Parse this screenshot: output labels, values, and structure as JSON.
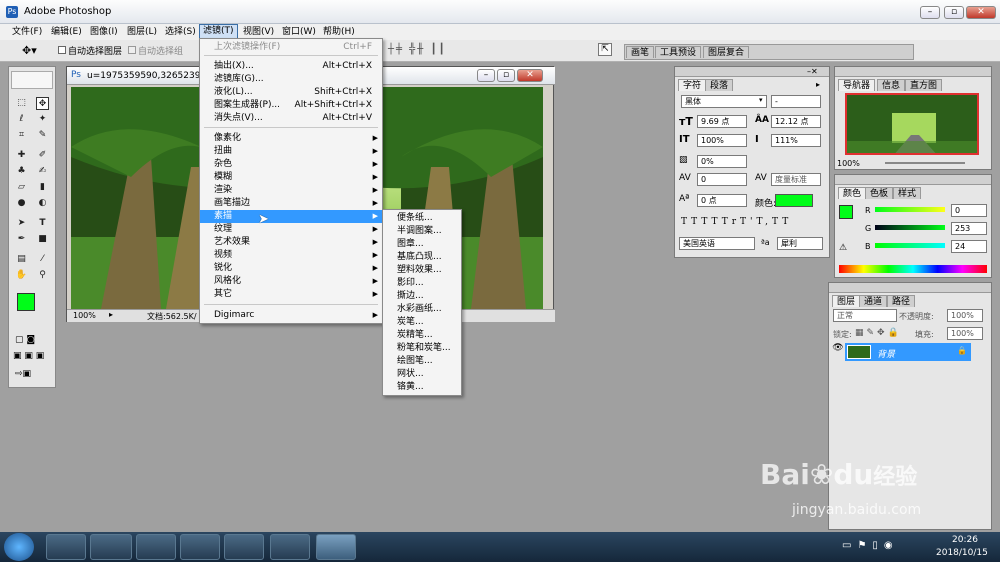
{
  "window": {
    "title": "Adobe Photoshop"
  },
  "menubar": [
    "文件(F)",
    "编辑(E)",
    "图像(I)",
    "图层(L)",
    "选择(S)",
    "滤镜(T)",
    "视图(V)",
    "窗口(W)",
    "帮助(H)"
  ],
  "options": {
    "auto_select_layer": "自动选择图层",
    "auto_select_group": "自动选择组",
    "right_tabs": [
      "画笔",
      "工具预设",
      "图层复合"
    ]
  },
  "document": {
    "title": "u=1975359590,3265239467",
    "zoom": "100%",
    "status": "文档:562.5K/"
  },
  "filter_menu": [
    {
      "label": "上次滤镜操作(F)",
      "shortcut": "Ctrl+F",
      "disabled": true
    },
    {
      "sep": true
    },
    {
      "label": "抽出(X)...",
      "shortcut": "Alt+Ctrl+X"
    },
    {
      "label": "滤镜库(G)..."
    },
    {
      "label": "液化(L)...",
      "shortcut": "Shift+Ctrl+X"
    },
    {
      "label": "图案生成器(P)...",
      "shortcut": "Alt+Shift+Ctrl+X"
    },
    {
      "label": "消失点(V)...",
      "shortcut": "Alt+Ctrl+V"
    },
    {
      "sep": true
    },
    {
      "label": "像素化",
      "sub": true
    },
    {
      "label": "扭曲",
      "sub": true
    },
    {
      "label": "杂色",
      "sub": true
    },
    {
      "label": "模糊",
      "sub": true
    },
    {
      "label": "渲染",
      "sub": true
    },
    {
      "label": "画笔描边",
      "sub": true
    },
    {
      "label": "素描",
      "sub": true,
      "highlighted": true
    },
    {
      "label": "纹理",
      "sub": true
    },
    {
      "label": "艺术效果",
      "sub": true
    },
    {
      "label": "视频",
      "sub": true
    },
    {
      "label": "锐化",
      "sub": true
    },
    {
      "label": "风格化",
      "sub": true
    },
    {
      "label": "其它",
      "sub": true
    },
    {
      "sep": true
    },
    {
      "label": "Digimarc",
      "sub": true
    }
  ],
  "sketch_submenu": [
    "便条纸...",
    "半调图案...",
    "图章...",
    "基底凸现...",
    "塑料效果...",
    "影印...",
    "撕边...",
    "水彩画纸...",
    "炭笔...",
    "炭精笔...",
    "粉笔和炭笔...",
    "绘图笔...",
    "网状...",
    "铬黄..."
  ],
  "character_panel": {
    "tabs": [
      "字符",
      "段落"
    ],
    "font": "黑体",
    "style": "-",
    "size": "9.69 点",
    "leading": "12.12 点",
    "vscale": "100%",
    "hscale": "111%",
    "tracking_pct": "0%",
    "kerning": "0",
    "kerning_mode": "度量标准",
    "baseline": "0 点",
    "color_label": "颜色:",
    "language": "美国英语",
    "aa_icon": "ªa",
    "antialias": "犀利",
    "style_buttons": [
      "T",
      "T",
      "TT",
      "Tr",
      "T'",
      "T,",
      "T",
      "T"
    ]
  },
  "navigator_panel": {
    "tabs": [
      "导航器",
      "信息",
      "直方图"
    ],
    "zoom": "100%"
  },
  "color_panel": {
    "tabs": [
      "颜色",
      "色板",
      "样式"
    ],
    "channels": [
      {
        "name": "R",
        "value": "0"
      },
      {
        "name": "G",
        "value": "253"
      },
      {
        "name": "B",
        "value": "24"
      }
    ],
    "foreground": "#00fd18"
  },
  "layers_panel": {
    "tabs": [
      "图层",
      "通道",
      "路径"
    ],
    "mode": "正常",
    "opacity_label": "不透明度:",
    "opacity": "100%",
    "lock_label": "锁定:",
    "fill_label": "填充:",
    "fill": "100%",
    "layers": [
      {
        "name": "背景"
      }
    ]
  },
  "taskbar": {
    "time": "20:26",
    "date": "2018/10/15"
  },
  "watermark": {
    "brand": "Bai",
    "brand2": "du",
    "cn": "经验",
    "url": "jingyan.baidu.com"
  },
  "colors": {
    "accent": "#3399ff",
    "fg_swatch": "#00fd18"
  }
}
